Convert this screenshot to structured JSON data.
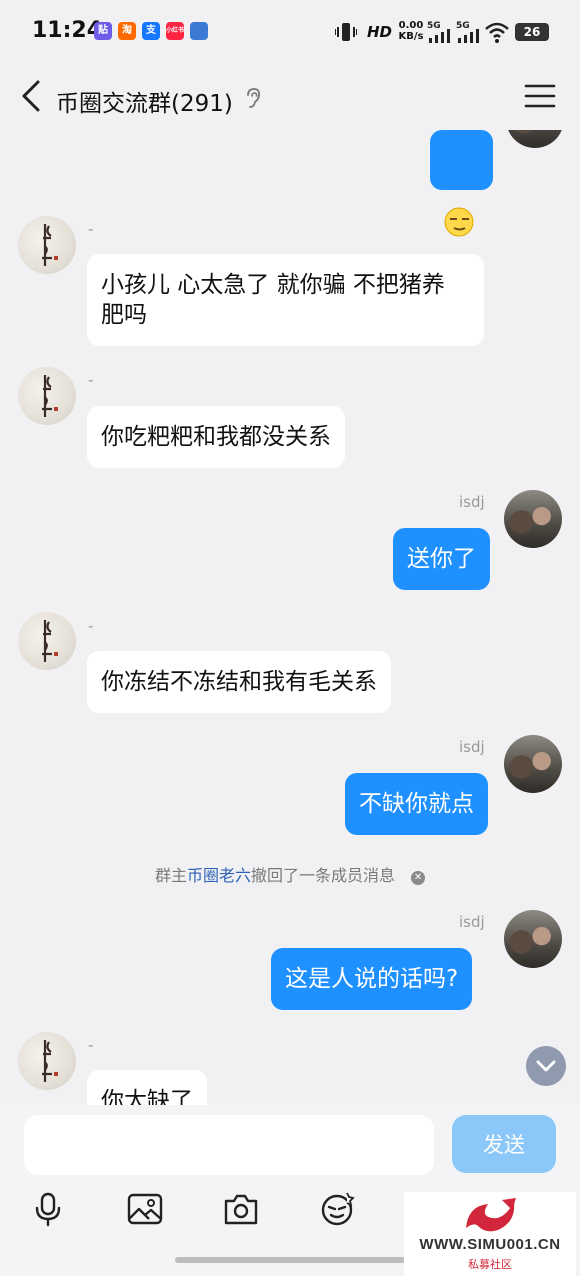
{
  "status_bar": {
    "time": "11:24",
    "app_icons": [
      {
        "name": "paste-app-icon",
        "label": "贴",
        "color": "#6d5ce7"
      },
      {
        "name": "taobao-app-icon",
        "label": "淘",
        "color": "#ff6a00"
      },
      {
        "name": "alipay-app-icon",
        "label": "支",
        "color": "#1677ff"
      },
      {
        "name": "hongbao-app-icon",
        "label": "小红书",
        "color": "#ff2442"
      },
      {
        "name": "chat-app-icon",
        "label": "",
        "color": "#3b7bd6"
      }
    ],
    "hd_label": "HD",
    "net_speed": "0.00",
    "net_unit": "KB/s",
    "signal_1": "5G",
    "signal_2": "5G",
    "battery": "26"
  },
  "header": {
    "title": "币圈交流群(291)"
  },
  "messages": [
    {
      "sender": "-",
      "text": "小孩儿 心太急了 就你骗 不把猪养\n肥吗"
    },
    {
      "sender": "-",
      "text": "你吃粑粑和我都没关系"
    },
    {
      "sender": "isdj",
      "text": "送你了"
    },
    {
      "sender": "-",
      "text": "你冻结不冻结和我有毛关系"
    },
    {
      "sender": "isdj",
      "text": "不缺你就点"
    },
    {
      "sender": "isdj",
      "text": "这是人说的话吗?"
    },
    {
      "sender": "-",
      "text": "你太缺了"
    }
  ],
  "recall_notice": {
    "prefix": "群主",
    "admin_name": "币圈老六",
    "suffix": "撤回了一条成员消息"
  },
  "input": {
    "placeholder": "",
    "send_label": "发送"
  },
  "watermark": {
    "url": "WWW.SIMU001.CN",
    "subtitle": "私募社区"
  },
  "colors": {
    "outgoing_bubble": "#1e90ff",
    "send_button": "#8cc7f9",
    "admin_link": "#2f63b7"
  }
}
